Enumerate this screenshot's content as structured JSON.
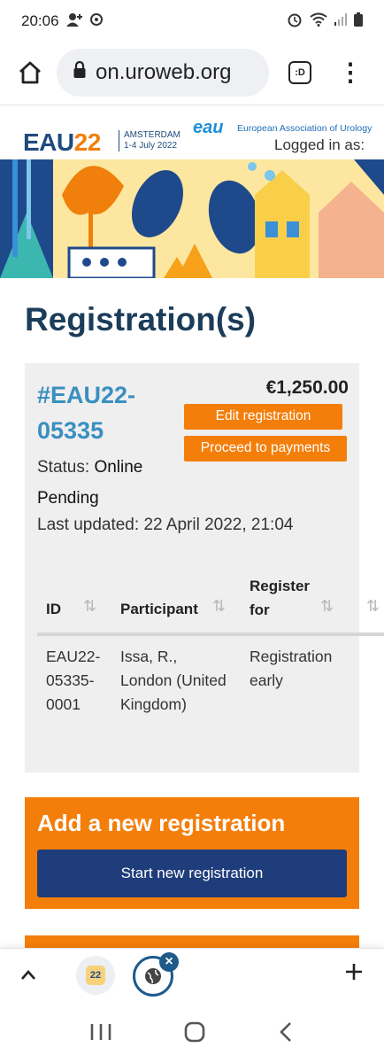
{
  "status_bar": {
    "time": "20:06"
  },
  "browser": {
    "url": "on.uroweb.org",
    "tab_badge": ":D"
  },
  "site": {
    "eau_prefix": "EAU",
    "eau_year": "22",
    "event_city": "AMSTERDAM",
    "event_dates": "1-4 July 2022",
    "org_logo": "eau",
    "org_name": "European Association of Urology",
    "logged_in_label": "Logged in as:"
  },
  "page": {
    "title": "Registration(s)"
  },
  "registration": {
    "id": "#EAU22-05335",
    "price": "€1,250.00",
    "edit_label": "Edit registration",
    "payment_label": "Proceed to payments",
    "status_label": "Status:",
    "status_value": "Online Pending",
    "updated_label": "Last updated:",
    "updated_value": "22 April 2022, 21:04",
    "table": {
      "headers": [
        "ID",
        "Participant",
        "Register for"
      ],
      "rows": [
        {
          "id": "EAU22-05335-0001",
          "participant": "Issa, R., London (United Kingdom)",
          "register_for": "Registration early"
        }
      ]
    }
  },
  "new_registration": {
    "title": "Add a new registration",
    "button_label": "Start new registration"
  },
  "tab_bar": {
    "tab_icon_text": "22"
  },
  "colors": {
    "accent_orange": "#f47e0a",
    "navy": "#1e3d7a",
    "heading": "#1c3d5a",
    "link_blue": "#3a8fc0"
  }
}
